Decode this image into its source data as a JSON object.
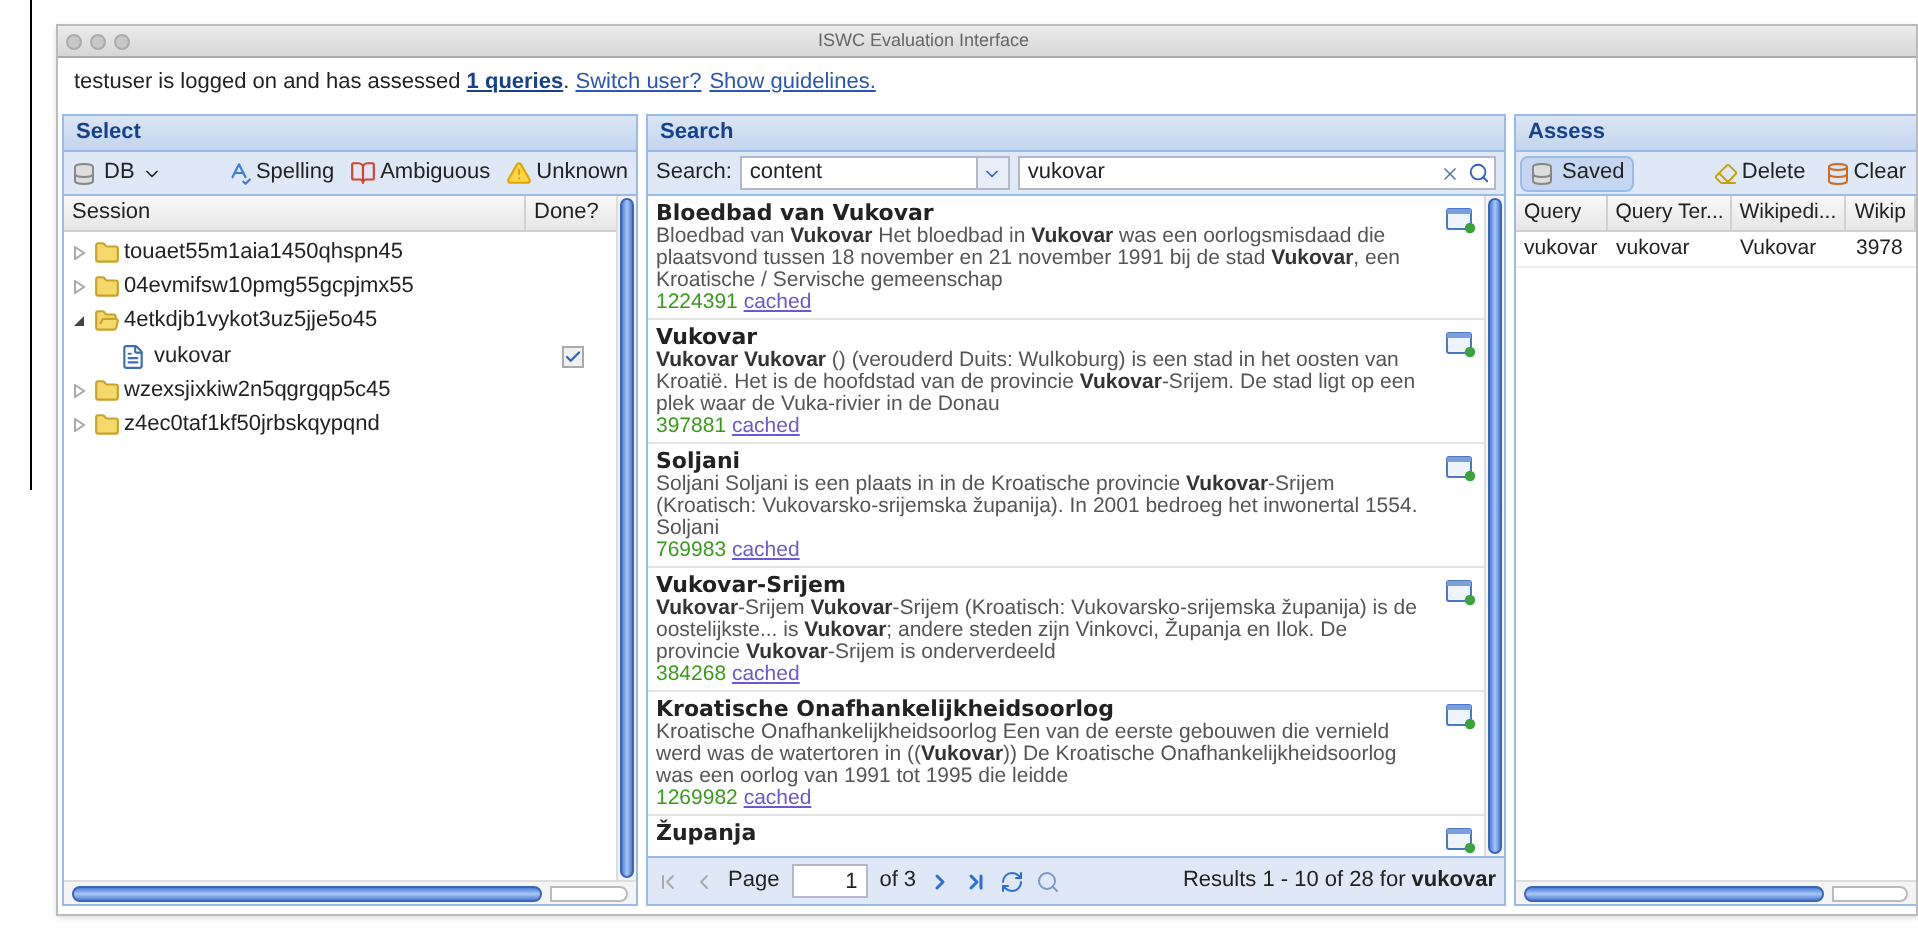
{
  "window": {
    "title": "ISWC Evaluation Interface"
  },
  "info": [
    {
      "kind": "text",
      "text": "testuser is logged on and has assessed "
    },
    {
      "kind": "link",
      "bold": true,
      "text": "1 queries"
    },
    {
      "kind": "text",
      "text": ". "
    },
    {
      "kind": "link",
      "bold": false,
      "text": "Switch user?"
    },
    {
      "kind": "link",
      "bold": false,
      "text": "Show guidelines."
    }
  ],
  "select": {
    "title": "Select",
    "db_button": "DB",
    "tools": [
      {
        "kind": "spelling",
        "label": "Spelling"
      },
      {
        "kind": "ambiguous",
        "label": "Ambiguous"
      },
      {
        "kind": "unknown",
        "label": "Unknown"
      }
    ],
    "columns": [
      "Session",
      "Done?"
    ],
    "sessions": [
      {
        "label": "touaet55m1aia1450qhspn45",
        "expanded": false
      },
      {
        "label": "04evmifsw10pmg55gcpjmx55",
        "expanded": false
      },
      {
        "label": "4etkdjb1vykot3uz5jje5o45",
        "expanded": true,
        "children": [
          {
            "label": "vukovar",
            "done": true
          }
        ]
      },
      {
        "label": "wzexsjixkiw2n5qgrgqp5c45",
        "expanded": false
      },
      {
        "label": "z4ec0taf1kf50jrbskqypqnd",
        "expanded": false
      }
    ]
  },
  "search": {
    "title": "Search",
    "label": "Search:",
    "field": "content",
    "query": "vukovar",
    "results": [
      {
        "title": "Bloedbad van Vukovar",
        "snippet": "Bloedbad van **Vukovar** Het bloedbad in **Vukovar** was een oorlogsmisdaad die plaatsvond tussen 18 november en 21 november 1991 bij de stad **Vukovar**, een Kroatische / Servische gemeenschap",
        "score": "1224391",
        "link": "cached"
      },
      {
        "title": "Vukovar",
        "snippet": "**Vukovar Vukovar** () (verouderd Duits: Wulkoburg) is een stad in het oosten van Kroatië. Het is de hoofdstad van de provincie **Vukovar**-Srijem. De stad ligt op een plek waar de Vuka-rivier in de Donau",
        "score": "397881",
        "link": "cached"
      },
      {
        "title": "Soljani",
        "snippet": "Soljani Soljani is een plaats in in de Kroatische provincie **Vukovar**-Srijem (Kroatisch: Vukovarsko-srijemska županija). In 2001 bedroeg het inwonertal 1554. Soljani",
        "score": "769983",
        "link": "cached"
      },
      {
        "title": "Vukovar-Srijem",
        "snippet": "**Vukovar**-Srijem **Vukovar**-Srijem (Kroatisch: Vukovarsko-srijemska županija) is de oostelijkste... is **Vukovar**; andere steden zijn Vinkovci, Županja en Ilok. De provincie **Vukovar**-Srijem is onderverdeeld",
        "score": "384268",
        "link": "cached"
      },
      {
        "title": "Kroatische Onafhankelijkheidsoorlog",
        "snippet": "Kroatische Onafhankelijkheidsoorlog Een van de eerste gebouwen die vernield werd was de watertoren in ((**Vukovar**)) De Kroatische Onafhankelijkheidsoorlog was een oorlog van 1991 tot 1995 die leidde",
        "score": "1269982",
        "link": "cached"
      },
      {
        "title": "Županja"
      }
    ],
    "pager": {
      "page_label": "Page",
      "page": "1",
      "of": "of 3",
      "summary": "Results 1 - 10 of 28 for **vukovar**"
    }
  },
  "assess": {
    "title": "Assess",
    "buttons": [
      {
        "kind": "saved",
        "label": "Saved",
        "pressed": true
      },
      {
        "kind": "delete",
        "label": "Delete",
        "pressed": false
      },
      {
        "kind": "clear",
        "label": "Clear",
        "pressed": false
      }
    ],
    "columns": [
      "Query",
      "Query Ter...",
      "Wikipedi...",
      "Wikip"
    ],
    "rows": [
      [
        "vukovar",
        "vukovar",
        "Vukovar",
        "3978"
      ]
    ]
  }
}
